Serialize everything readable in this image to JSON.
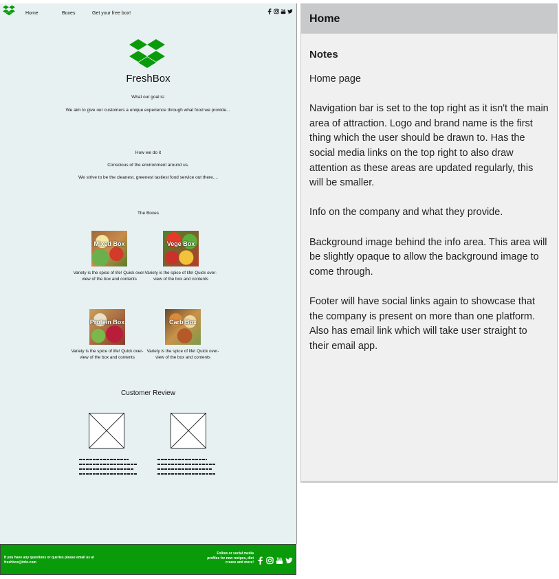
{
  "wireframe": {
    "nav": {
      "items": [
        "Home",
        "Boxes",
        "Get your free box!"
      ],
      "social_icons": [
        "facebook-icon",
        "instagram-icon",
        "youtube-icon",
        "twitter-icon"
      ]
    },
    "brand_name": "FreshBox",
    "goal": {
      "heading": "What our goal is:",
      "text": "We aim to give our customers a unique experience through what food we provide..."
    },
    "how": {
      "heading": "How we do it",
      "line1": "Conscious of the environment around us.",
      "line2": "We strive to be the cleanest, greenest tastiest food service out there...."
    },
    "boxes": {
      "heading": "The Boxes",
      "items": [
        {
          "label": "Mixed Box",
          "desc": "Variety is the spice of life! Quick over-view of the box and contents"
        },
        {
          "label": "Vege Box",
          "desc": "Variety is the spice of life! Quick over-view of the box and contents"
        },
        {
          "label": "Protein Box",
          "desc": "Variety is the spice of life! Quick over-view of the box and contents"
        },
        {
          "label": "Carb Box",
          "desc": "Variety is the spice of life! Quick over-view of the box and contents"
        }
      ]
    },
    "reviews": {
      "heading": "Customer Review"
    },
    "footer": {
      "contact": "If you have any questions or queries please email us at freshbox@info.com",
      "follow": "Follow or social media profiles for new recipes, diet crazes and more!"
    },
    "colors": {
      "brand_green": "#0a9b0a",
      "page_bg": "#e8f1f1"
    }
  },
  "notes": {
    "title": "Home",
    "heading": "Notes",
    "paragraphs": [
      "Home page",
      "Navigation bar is set to the top right as it isn't the main area of attraction. Logo and brand name is the first thing which the user should be drawn to. Has the social media links on the top right to also draw attention as these areas are updated regularly, this will be smaller.",
      "Info on the company and what they provide.",
      "Background image behind the info area. This area will be slightly opaque to allow the background image to come through.",
      "Footer will have social links again to showcase that the company is present on more than one platform. Also has email link which will take user straight to their email app."
    ]
  }
}
